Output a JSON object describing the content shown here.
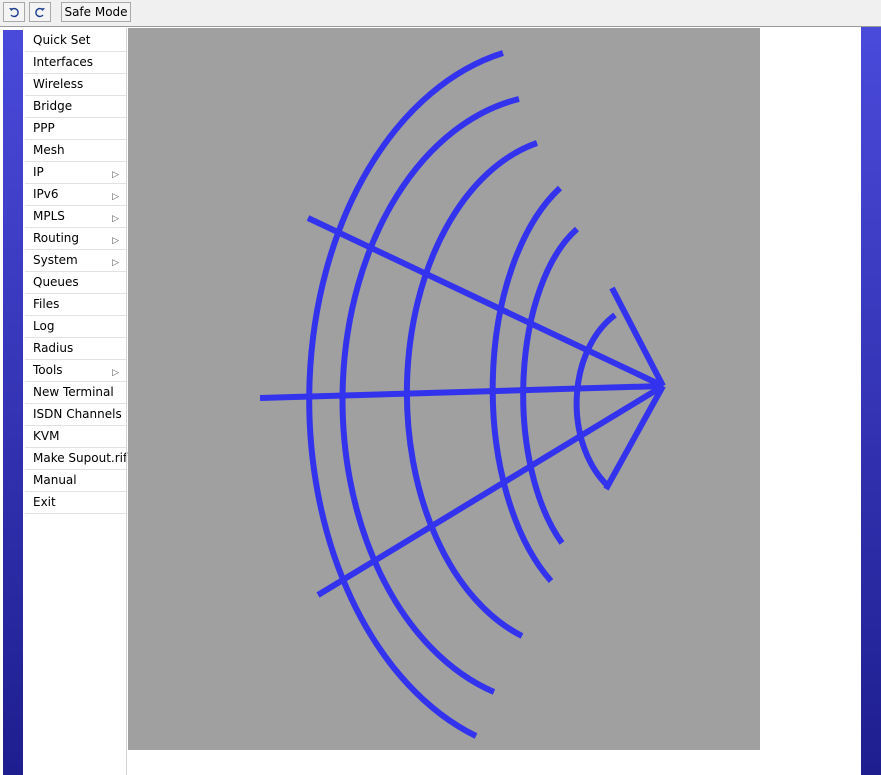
{
  "toolbar": {
    "undo_icon": "undo-icon",
    "redo_icon": "redo-icon",
    "safe_mode_label": "Safe Mode"
  },
  "menu": {
    "items": [
      {
        "label": "Quick Set",
        "submenu": false
      },
      {
        "label": "Interfaces",
        "submenu": false
      },
      {
        "label": "Wireless",
        "submenu": false
      },
      {
        "label": "Bridge",
        "submenu": false
      },
      {
        "label": "PPP",
        "submenu": false
      },
      {
        "label": "Mesh",
        "submenu": false
      },
      {
        "label": "IP",
        "submenu": true
      },
      {
        "label": "IPv6",
        "submenu": true
      },
      {
        "label": "MPLS",
        "submenu": true
      },
      {
        "label": "Routing",
        "submenu": true
      },
      {
        "label": "System",
        "submenu": true
      },
      {
        "label": "Queues",
        "submenu": false
      },
      {
        "label": "Files",
        "submenu": false
      },
      {
        "label": "Log",
        "submenu": false
      },
      {
        "label": "Radius",
        "submenu": false
      },
      {
        "label": "Tools",
        "submenu": true
      },
      {
        "label": "New Terminal",
        "submenu": false
      },
      {
        "label": "ISDN Channels",
        "submenu": false
      },
      {
        "label": "KVM",
        "submenu": false
      },
      {
        "label": "Make Supout.rif",
        "submenu": false
      },
      {
        "label": "Manual",
        "submenu": false
      },
      {
        "label": "Exit",
        "submenu": false
      }
    ]
  },
  "graphic": {
    "name": "antenna-pattern-graphic",
    "stroke_color": "#3333ee",
    "background_color": "#a0a0a0"
  },
  "colors": {
    "sidebar_gradient_top": "#4a4adb",
    "sidebar_gradient_bottom": "#1e1e8f"
  }
}
